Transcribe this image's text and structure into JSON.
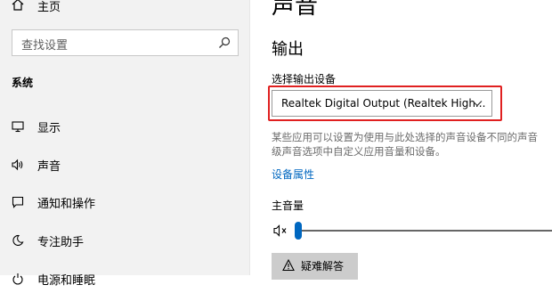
{
  "sidebar": {
    "home_label": "主页",
    "search_placeholder": "查找设置",
    "section_label": "系统",
    "items": [
      {
        "label": "显示",
        "icon": "monitor-icon"
      },
      {
        "label": "声音",
        "icon": "speaker-icon"
      },
      {
        "label": "通知和操作",
        "icon": "notification-icon"
      },
      {
        "label": "专注助手",
        "icon": "moon-icon"
      },
      {
        "label": "电源和睡眠",
        "icon": "power-icon"
      }
    ],
    "selected": "声音"
  },
  "main": {
    "page_title": "声音",
    "output_heading": "输出",
    "select_device_label": "选择输出设备",
    "selected_device": "Realtek Digital Output (Realtek High...",
    "description_lines": [
      "某些应用可以设置为使用与此处选择的声音设备不同的声音",
      "级声音选项中自定义应用音量和设备。"
    ],
    "device_properties_link": "设备属性",
    "master_volume_label": "主音量",
    "master_volume_level": 0,
    "troubleshoot_label": "疑难解答"
  },
  "colors": {
    "accent": "#0067c0",
    "highlight_box": "#e02020",
    "sidebar_bg": "#f2f2f2"
  }
}
